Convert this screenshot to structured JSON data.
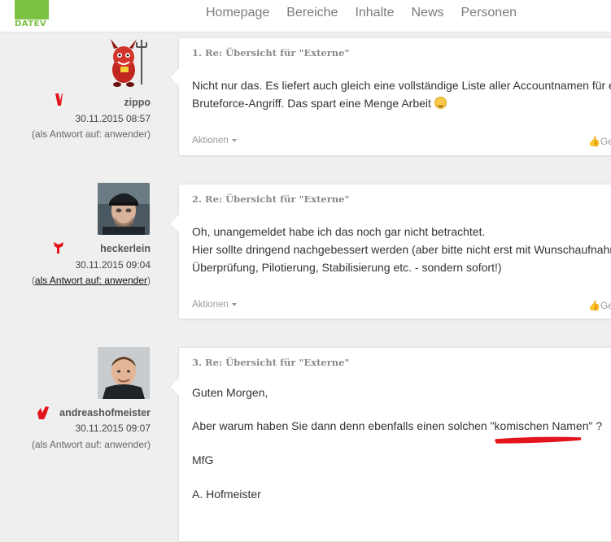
{
  "header": {
    "logo_text": "DATEV",
    "nav": [
      "Homepage",
      "Bereiche",
      "Inhalte",
      "News",
      "Personen"
    ]
  },
  "posts": [
    {
      "title": "1. Re: Übersicht für \"Externe\"",
      "username": "zippo",
      "date": "30.11.2015 08:57",
      "reply_prefix": "(als Antwort auf: ",
      "reply_to": "anwender",
      "reply_suffix": ")",
      "body_lines": [
        "Nicht nur das. Es liefert auch gleich eine vollständige Liste aller Accountnamen für e",
        "Bruteforce-Angriff. Das spart eine Menge Arbeit"
      ],
      "actions": "Aktionen",
      "like": "Ge"
    },
    {
      "title": "2. Re: Übersicht für \"Externe\"",
      "username": "heckerlein",
      "date": "30.11.2015 09:04",
      "reply_prefix": "(",
      "reply_to": "als Antwort auf: anwender",
      "reply_suffix": ")",
      "body_lines": [
        "Oh, unangemeldet habe ich das noch gar nicht betrachtet.",
        "Hier sollte dringend nachgebessert werden (aber bitte nicht erst mit Wunschaufnahr",
        "Überprüfung, Pilotierung, Stabilisierung etc. - sondern sofort!)"
      ],
      "actions": "Aktionen",
      "like": "Ge"
    },
    {
      "title": "3. Re: Übersicht für \"Externe\"",
      "username": "andreashofmeister",
      "date": "30.11.2015 09:07",
      "reply_prefix": "(als Antwort auf: ",
      "reply_to": "anwender",
      "reply_suffix": ")",
      "body_lines": [
        "Guten Morgen,",
        "Aber warum haben Sie dann denn ebenfalls einen solchen \"komischen Namen\" ?",
        "MfG",
        "A. Hofmeister"
      ]
    }
  ],
  "colors": {
    "brand_green": "#7cc142",
    "badge_red": "#e3141c",
    "annotation_red": "#e3141c"
  }
}
